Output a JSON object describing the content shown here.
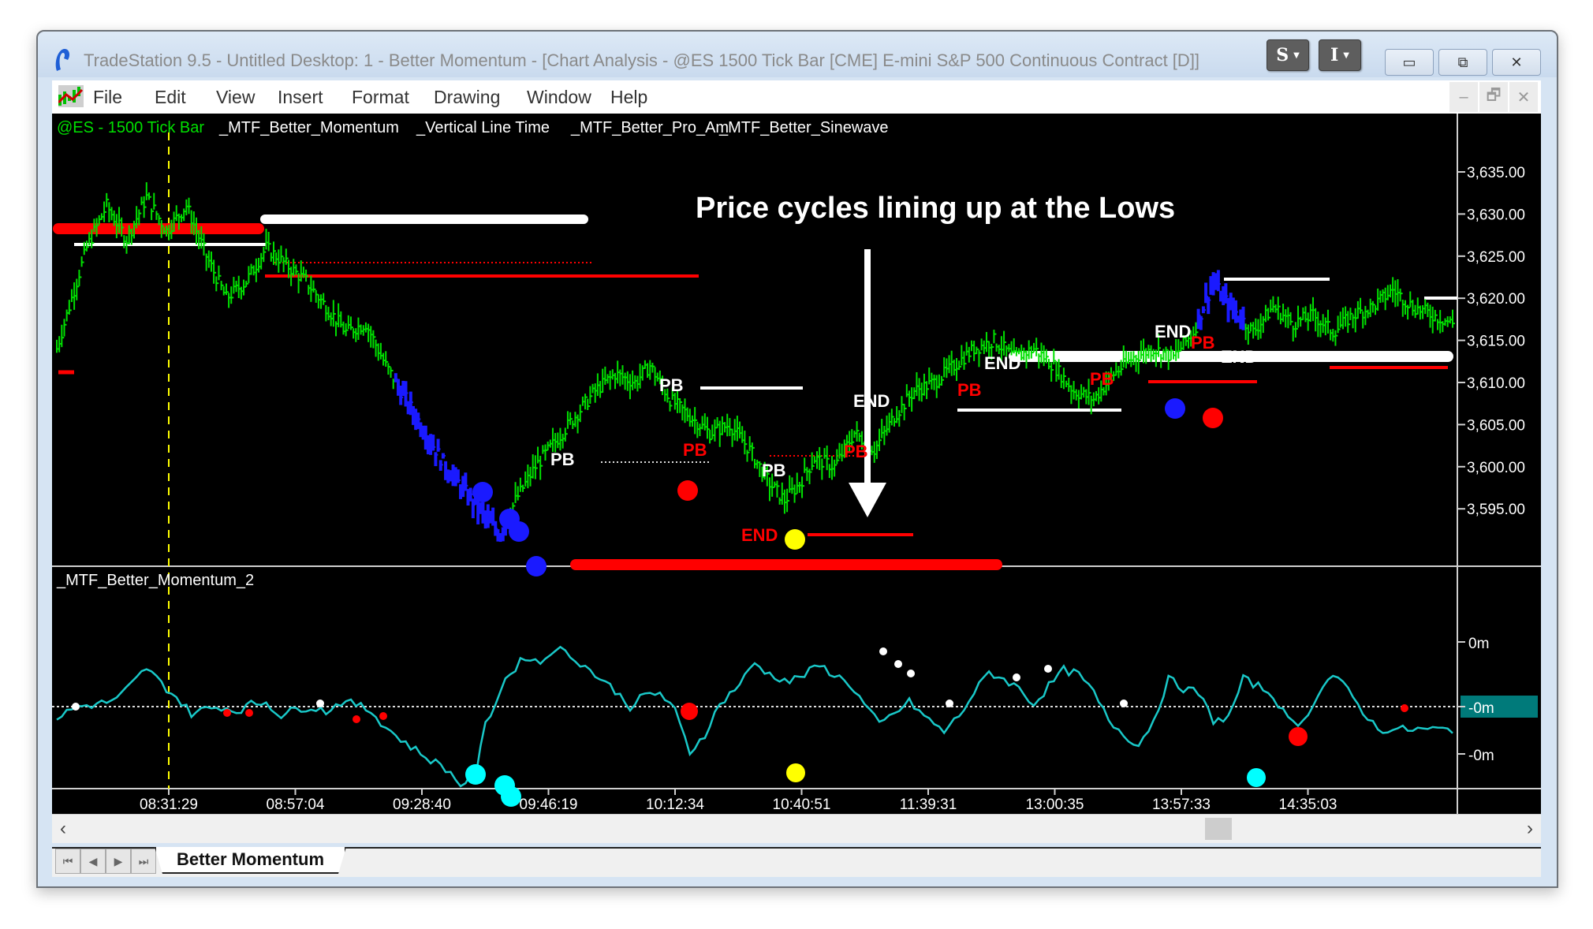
{
  "window": {
    "title": "TradeStation 9.5 - Untitled Desktop: 1 - Better Momentum - [Chart Analysis - @ES 1500 Tick Bar [CME] E-mini S&P 500 Continuous Contract [D",
    "title_tail": "]]",
    "overlay_buttons": [
      {
        "label": "S",
        "icon": "caret-down-icon"
      },
      {
        "label": "I",
        "icon": "caret-down-icon"
      }
    ],
    "controls": {
      "minimize": "▭",
      "restore": "⧉",
      "close": "✕"
    }
  },
  "menu": {
    "items": [
      "File",
      "Edit",
      "View",
      "Insert",
      "Format",
      "Drawing",
      "Window",
      "Help"
    ],
    "mdi_controls": {
      "minimize": "–",
      "restore": "🗗",
      "close": "✕"
    }
  },
  "chart": {
    "symbol_label": "@ES - 1500 Tick Bar",
    "indicator_labels": [
      "_MTF_Better_Momentum",
      "_Vertical Line Time",
      "_MTF_Better_Pro_Am",
      "_MTF_Better_Sinewave"
    ],
    "annotation": "Price cycles lining up at the Lows",
    "oscillator_label": "_MTF_Better_Momentum_2",
    "colors": {
      "bars_up": "#00e000",
      "bars_trend_down": "#1a1aff",
      "osc_line": "#19c8c8",
      "red": "#ff0000",
      "white": "#ffffff",
      "yellow": "#ffff00",
      "cyan": "#00ffff",
      "blue": "#1a1aff",
      "axis_highlight": "#007a7a"
    },
    "markers": {
      "end_white": [
        "END",
        "END",
        "END",
        "END"
      ],
      "end_red": [
        "END"
      ],
      "pb_white": [
        "PB",
        "PB",
        "PB"
      ],
      "pb_red": [
        "PB",
        "PB",
        "PB",
        "PB",
        "PB",
        "PB"
      ]
    }
  },
  "chart_data": {
    "type": "line",
    "title": "@ES - 1500 Tick Bar",
    "price_axis": {
      "ticks": [
        "3,635.00",
        "3,630.00",
        "3,625.00",
        "3,620.00",
        "3,615.00",
        "3,610.00",
        "3,605.00",
        "3,600.00",
        "3,595.00"
      ],
      "range": [
        3590,
        3638
      ]
    },
    "oscillator_axis": {
      "ticks": [
        "0m",
        "-0m",
        "-0m"
      ],
      "highlighted": "-0m"
    },
    "time_axis": {
      "ticks": [
        "08:31:29",
        "08:57:04",
        "09:28:40",
        "09:46:19",
        "10:12:34",
        "10:40:51",
        "11:39:31",
        "13:00:35",
        "13:57:33",
        "14:35:03"
      ]
    },
    "price_path": [
      [
        0,
        3614
      ],
      [
        3,
        3620
      ],
      [
        6,
        3626
      ],
      [
        10,
        3631
      ],
      [
        14,
        3627
      ],
      [
        18,
        3632
      ],
      [
        22,
        3628
      ],
      [
        26,
        3631
      ],
      [
        30,
        3625
      ],
      [
        34,
        3620
      ],
      [
        38,
        3622
      ],
      [
        42,
        3626
      ],
      [
        46,
        3624
      ],
      [
        50,
        3622
      ],
      [
        54,
        3619
      ],
      [
        58,
        3616
      ],
      [
        62,
        3617
      ],
      [
        66,
        3612
      ],
      [
        70,
        3608
      ],
      [
        74,
        3604
      ],
      [
        78,
        3600
      ],
      [
        82,
        3597
      ],
      [
        86,
        3594
      ],
      [
        89,
        3592
      ],
      [
        92,
        3596
      ],
      [
        96,
        3600
      ],
      [
        100,
        3603
      ],
      [
        104,
        3606
      ],
      [
        108,
        3609
      ],
      [
        112,
        3611
      ],
      [
        116,
        3610
      ],
      [
        119,
        3612
      ],
      [
        123,
        3608
      ],
      [
        127,
        3606
      ],
      [
        131,
        3604
      ],
      [
        135,
        3605
      ],
      [
        139,
        3602
      ],
      [
        143,
        3598
      ],
      [
        146,
        3596
      ],
      [
        149,
        3598
      ],
      [
        152,
        3601
      ],
      [
        156,
        3600
      ],
      [
        160,
        3604
      ],
      [
        164,
        3602
      ],
      [
        168,
        3606
      ],
      [
        172,
        3609
      ],
      [
        176,
        3610
      ],
      [
        180,
        3612
      ],
      [
        184,
        3614
      ],
      [
        188,
        3615
      ],
      [
        192,
        3613
      ],
      [
        196,
        3614
      ],
      [
        200,
        3612
      ],
      [
        204,
        3609
      ],
      [
        208,
        3608
      ],
      [
        212,
        3611
      ],
      [
        216,
        3613
      ],
      [
        220,
        3614
      ],
      [
        224,
        3613
      ],
      [
        228,
        3616
      ],
      [
        232,
        3622
      ],
      [
        234,
        3620
      ],
      [
        237,
        3618
      ],
      [
        240,
        3616
      ],
      [
        244,
        3619
      ],
      [
        248,
        3617
      ],
      [
        252,
        3618
      ],
      [
        256,
        3616
      ],
      [
        260,
        3618
      ],
      [
        264,
        3619
      ],
      [
        268,
        3621
      ],
      [
        272,
        3619
      ],
      [
        276,
        3618
      ],
      [
        280,
        3617
      ]
    ],
    "price_trend_down_range": [
      [
        68,
        90
      ],
      [
        229,
        238
      ]
    ],
    "oscillator_path": [
      [
        0,
        -0.25
      ],
      [
        4,
        0.0
      ],
      [
        8,
        0.05
      ],
      [
        12,
        0.15
      ],
      [
        16,
        0.6
      ],
      [
        18,
        0.85
      ],
      [
        21,
        0.5
      ],
      [
        24,
        0.2
      ],
      [
        27,
        -0.15
      ],
      [
        30,
        -0.05
      ],
      [
        33,
        0.0
      ],
      [
        36,
        -0.1
      ],
      [
        39,
        0.05
      ],
      [
        42,
        0.1
      ],
      [
        45,
        -0.2
      ],
      [
        48,
        -0.05
      ],
      [
        51,
        0.0
      ],
      [
        54,
        -0.1
      ],
      [
        57,
        0.1
      ],
      [
        60,
        0.05
      ],
      [
        63,
        -0.1
      ],
      [
        66,
        -0.45
      ],
      [
        70,
        -0.8
      ],
      [
        74,
        -1.1
      ],
      [
        78,
        -1.35
      ],
      [
        81,
        -1.7
      ],
      [
        84,
        -1.5
      ],
      [
        86,
        -0.4
      ],
      [
        90,
        0.6
      ],
      [
        94,
        1.1
      ],
      [
        97,
        0.95
      ],
      [
        100,
        1.3
      ],
      [
        104,
        1.05
      ],
      [
        108,
        0.7
      ],
      [
        112,
        0.35
      ],
      [
        115,
        0.0
      ],
      [
        118,
        0.25
      ],
      [
        121,
        0.3
      ],
      [
        124,
        -0.1
      ],
      [
        127,
        -1.0
      ],
      [
        130,
        -0.6
      ],
      [
        133,
        0.05
      ],
      [
        137,
        0.5
      ],
      [
        140,
        0.95
      ],
      [
        143,
        0.7
      ],
      [
        147,
        0.55
      ],
      [
        150,
        0.7
      ],
      [
        153,
        0.9
      ],
      [
        156,
        0.7
      ],
      [
        159,
        0.5
      ],
      [
        162,
        0.05
      ],
      [
        165,
        -0.4
      ],
      [
        168,
        -0.15
      ],
      [
        171,
        0.1
      ],
      [
        175,
        -0.3
      ],
      [
        178,
        -0.55
      ],
      [
        181,
        -0.2
      ],
      [
        184,
        0.3
      ],
      [
        187,
        0.75
      ],
      [
        190,
        0.6
      ],
      [
        193,
        0.4
      ],
      [
        196,
        0.05
      ],
      [
        199,
        0.45
      ],
      [
        202,
        0.8
      ],
      [
        205,
        0.7
      ],
      [
        208,
        0.3
      ],
      [
        211,
        -0.3
      ],
      [
        214,
        -0.6
      ],
      [
        217,
        -0.85
      ],
      [
        220,
        -0.3
      ],
      [
        223,
        0.6
      ],
      [
        226,
        0.4
      ],
      [
        229,
        0.3
      ],
      [
        232,
        -0.3
      ],
      [
        235,
        -0.25
      ],
      [
        238,
        0.6
      ],
      [
        241,
        0.45
      ],
      [
        244,
        0.25
      ],
      [
        247,
        -0.3
      ],
      [
        250,
        -0.35
      ],
      [
        253,
        0.3
      ],
      [
        256,
        0.7
      ],
      [
        259,
        0.35
      ],
      [
        262,
        -0.1
      ],
      [
        265,
        -0.5
      ]
    ]
  },
  "scrollbar": {
    "left_arrow": "‹",
    "right_arrow": "›"
  },
  "tabs": {
    "nav": [
      "⏮",
      "◀",
      "▶",
      "⏭"
    ],
    "items": [
      {
        "label": "Better Momentum",
        "active": true
      }
    ]
  }
}
